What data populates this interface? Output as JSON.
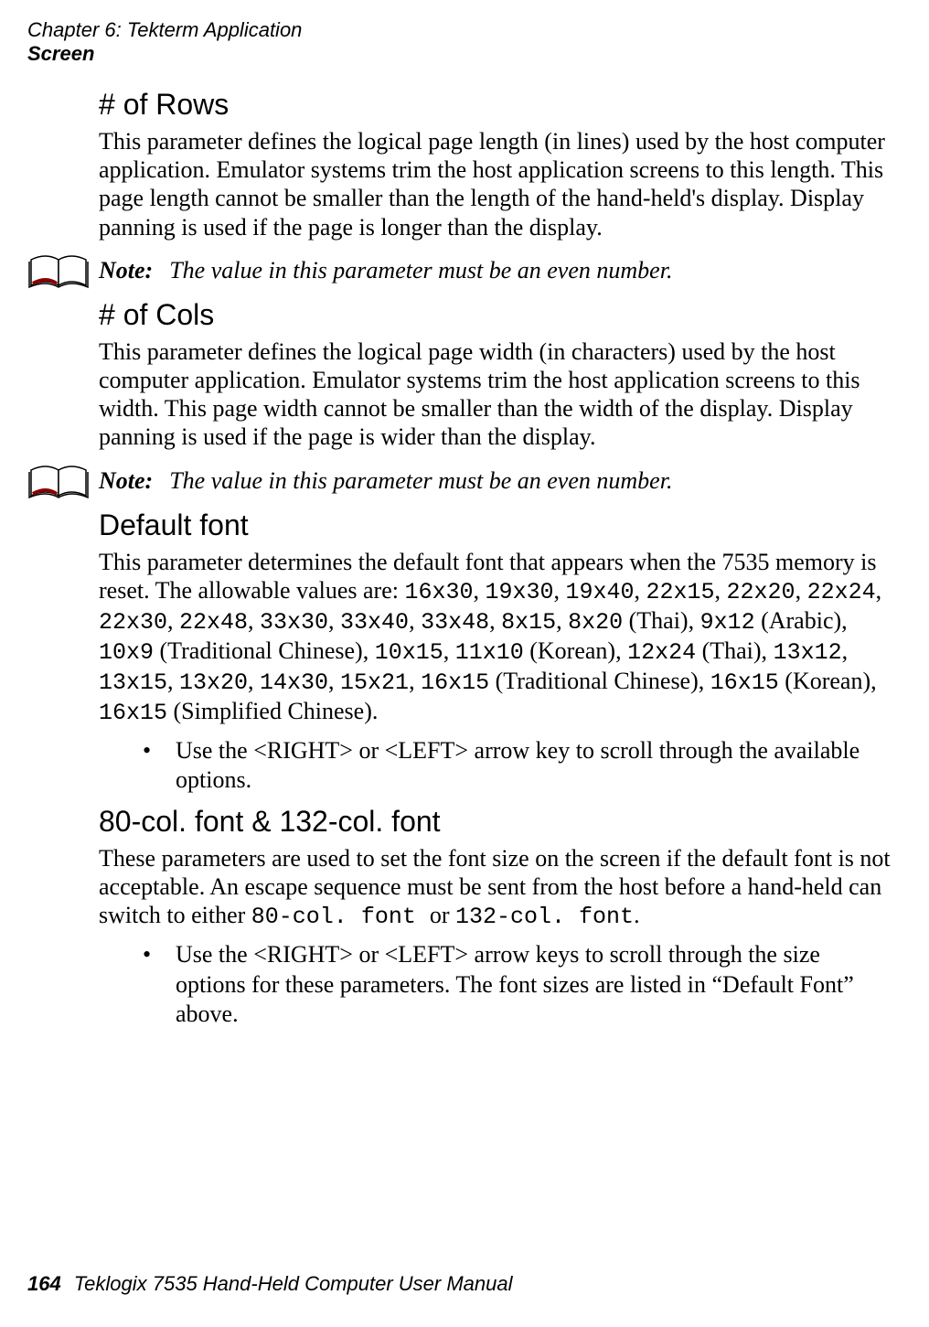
{
  "header": {
    "chapter": "Chapter 6: Tekterm Application",
    "section": "Screen"
  },
  "sections": {
    "rows": {
      "title": "# of Rows",
      "para": "This parameter defines the logical page length (in lines) used by the host computer application. Emulator systems trim the host application screens to this length. This page length cannot be smaller than the length of the hand-held's display. Display panning is used if the page is longer than the display.",
      "note_label": "Note:",
      "note": "The value in this parameter must be an even number."
    },
    "cols": {
      "title": "# of Cols",
      "para": "This parameter defines the logical page width (in characters) used by the host computer application. Emulator systems trim the host application screens to this width. This page width cannot be smaller than the width of the display. Display panning is used if the page is wider than the display.",
      "note_label": "Note:",
      "note": "The value in this parameter must be an even number."
    },
    "font": {
      "title": "Default font",
      "p_pre": "This parameter determines the default font that appears when the 7535 memory is reset. The allowable values are: ",
      "v1": "16x30",
      "v2": "19x30",
      "v3": "19x40",
      "v4": "22x15",
      "v5": "22x20",
      "v6": "22x24",
      "v7": "22x30",
      "v8": "22x48",
      "v9": "33x30",
      "v10": "33x40",
      "v11": "33x48",
      "v12": "8x15",
      "v13": "8x20",
      "t13": " (Thai), ",
      "v14": "9x12",
      "t14": " (Arabic), ",
      "v15": "10x9",
      "t15": " (Traditional Chinese), ",
      "v16": "10x15",
      "v17": "11x10",
      "t17": " (Korean), ",
      "v18": "12x24",
      "t18": " (Thai), ",
      "v19": "13x12",
      "v20": "13x15",
      "v21": "13x20",
      "v22": "14x30",
      "v23": "15x21",
      "v24a": "16x15",
      "t24a": "  (Traditional Chinese), ",
      "v24b": "16x15",
      "t24b": " (Korean), ",
      "v25": "16x15",
      "t25": " (Simplified Chinese).",
      "bullet": "Use the <RIGHT> or <LEFT> arrow key to scroll through the available options."
    },
    "colfont": {
      "title": "80-col. font & 132-col. font",
      "p_pre": "These parameters are used to set the font size on the screen if the default font is not acceptable. An escape sequence must be sent from the host before a hand-held can switch to either ",
      "m1": " 80-col. font ",
      "mid": " or ",
      "m2": " 132-col. font",
      "end": ".",
      "bullet": "Use the <RIGHT> or <LEFT> arrow keys to scroll through the size options for these parameters. The font sizes are listed in “Default Font” above."
    }
  },
  "footer": {
    "page": "164",
    "title": "Teklogix 7535 Hand-Held Computer User Manual"
  }
}
